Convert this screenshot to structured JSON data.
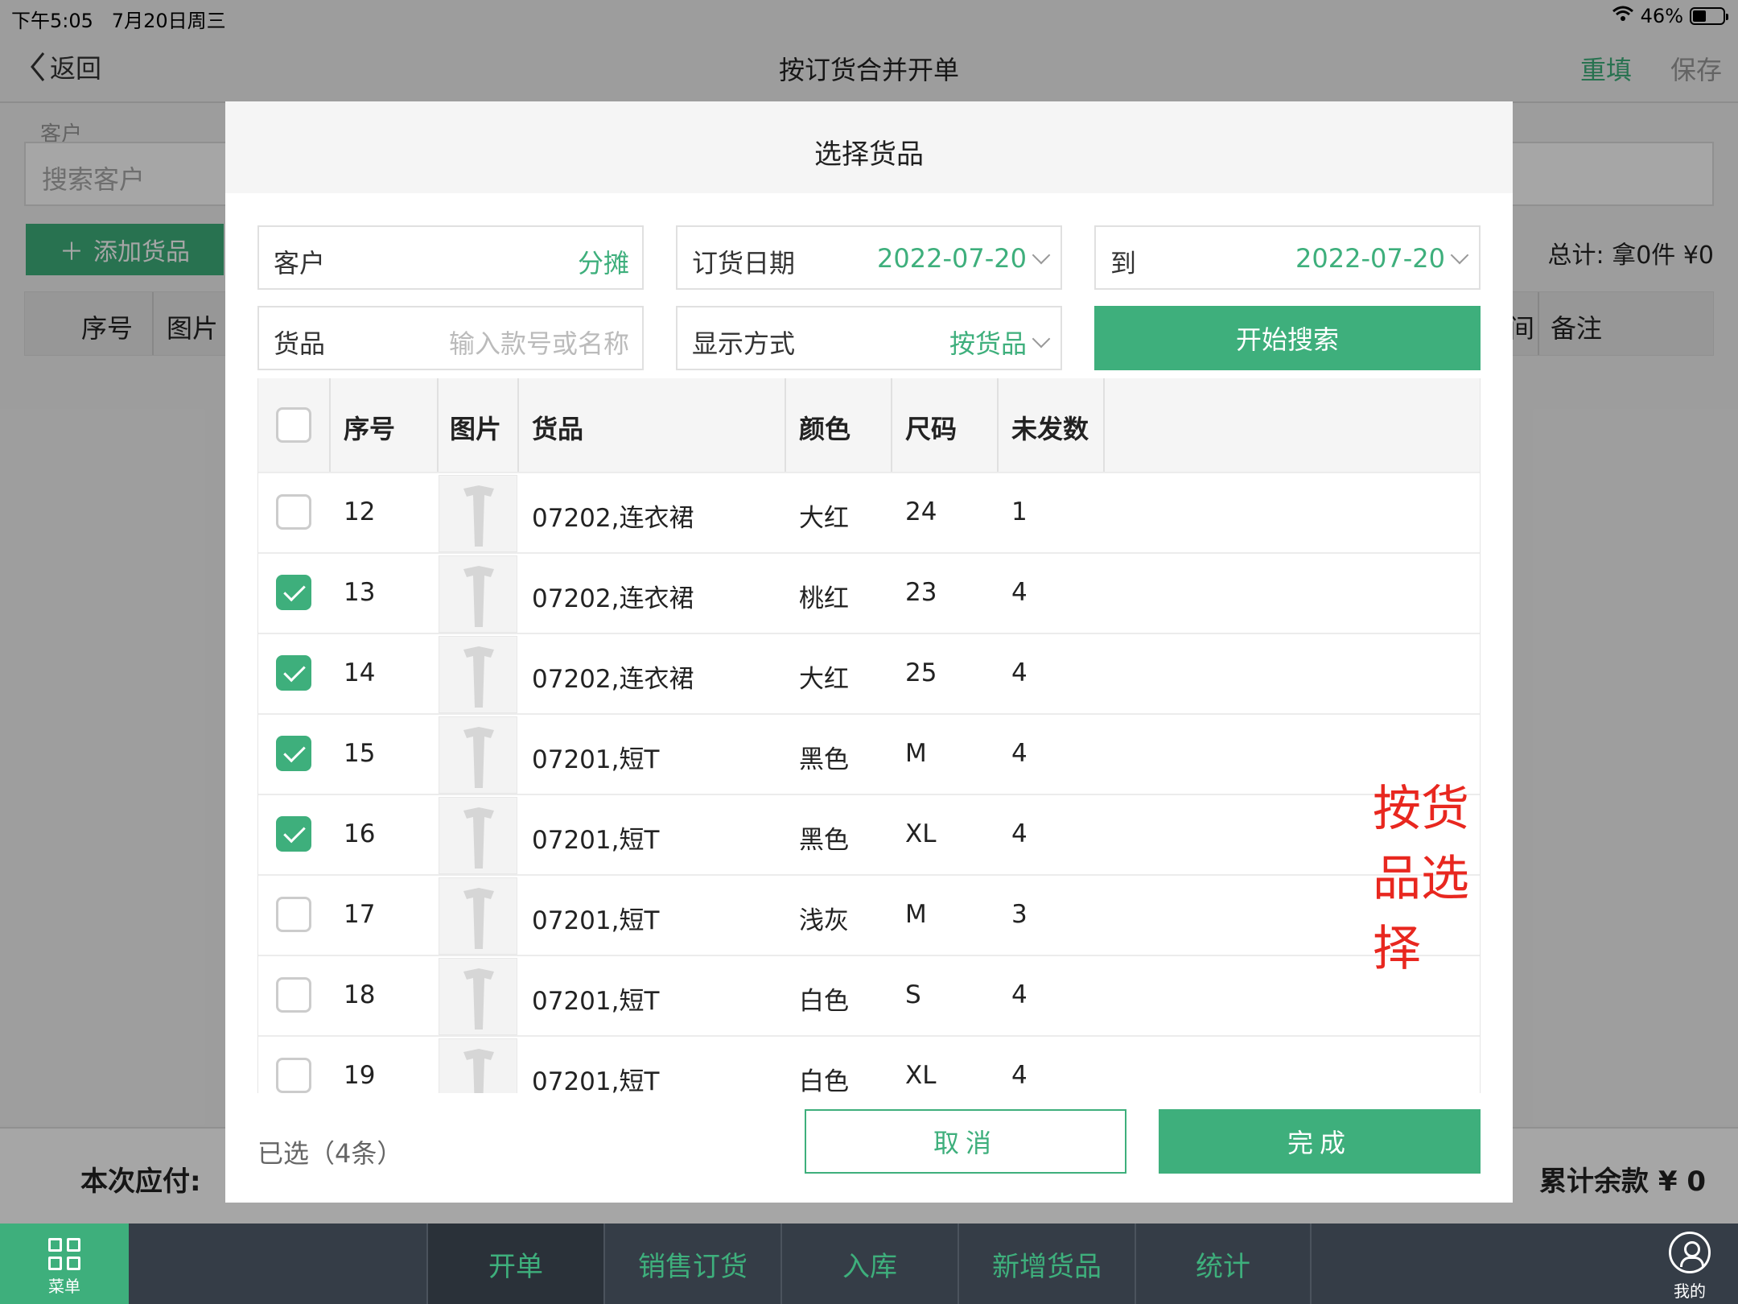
{
  "status_bar": {
    "time": "下午5:05",
    "date": "7月20日周三",
    "battery": "46%"
  },
  "navbar": {
    "back_label": "返回",
    "title": "按订货合并开单",
    "reset_label": "重填",
    "save_label": "保存"
  },
  "background": {
    "customer_label": "客户",
    "customer_placeholder": "搜索客户",
    "add_goods_label": "添加货品",
    "total_text": "总计:  拿0件  ¥0",
    "columns": [
      "序号",
      "图片",
      "间",
      "备注"
    ],
    "payable_label": "本次应付:",
    "balance_text": "累计余款 ¥ 0"
  },
  "modal": {
    "title": "选择货品",
    "customer_label": "客户",
    "customer_value": "分摊",
    "order_date_label": "订货日期",
    "order_date_value": "2022-07-20",
    "to_label": "到",
    "to_date_value": "2022-07-20",
    "goods_label": "货品",
    "goods_placeholder": "输入款号或名称",
    "display_label": "显示方式",
    "display_value": "按货品",
    "search_button": "开始搜索",
    "columns": [
      "序号",
      "图片",
      "货品",
      "颜色",
      "尺码",
      "未发数"
    ],
    "rows": [
      {
        "checked": false,
        "no": "12",
        "goods": "07202,连衣裙",
        "color": "大红",
        "size": "24",
        "unsent": "1"
      },
      {
        "checked": true,
        "no": "13",
        "goods": "07202,连衣裙",
        "color": "桃红",
        "size": "23",
        "unsent": "4"
      },
      {
        "checked": true,
        "no": "14",
        "goods": "07202,连衣裙",
        "color": "大红",
        "size": "25",
        "unsent": "4"
      },
      {
        "checked": true,
        "no": "15",
        "goods": "07201,短T",
        "color": "黑色",
        "size": "M",
        "unsent": "4"
      },
      {
        "checked": true,
        "no": "16",
        "goods": "07201,短T",
        "color": "黑色",
        "size": "XL",
        "unsent": "4"
      },
      {
        "checked": false,
        "no": "17",
        "goods": "07201,短T",
        "color": "浅灰",
        "size": "M",
        "unsent": "3"
      },
      {
        "checked": false,
        "no": "18",
        "goods": "07201,短T",
        "color": "白色",
        "size": "S",
        "unsent": "4"
      },
      {
        "checked": false,
        "no": "19",
        "goods": "07201,短T",
        "color": "白色",
        "size": "XL",
        "unsent": "4"
      }
    ],
    "annotation": "按货品选择",
    "selected_text": "已选（4条）",
    "cancel_button": "取消",
    "done_button": "完成"
  },
  "tabbar": {
    "menu_label": "菜单",
    "tabs": [
      "开单",
      "销售订货",
      "入库",
      "新增货品",
      "统计"
    ],
    "active_tab": "开单",
    "mine_label": "我的"
  },
  "colors": {
    "accent": "#3eaf7c",
    "annotation": "#e8271f",
    "tabbar_bg": "#353d47"
  }
}
